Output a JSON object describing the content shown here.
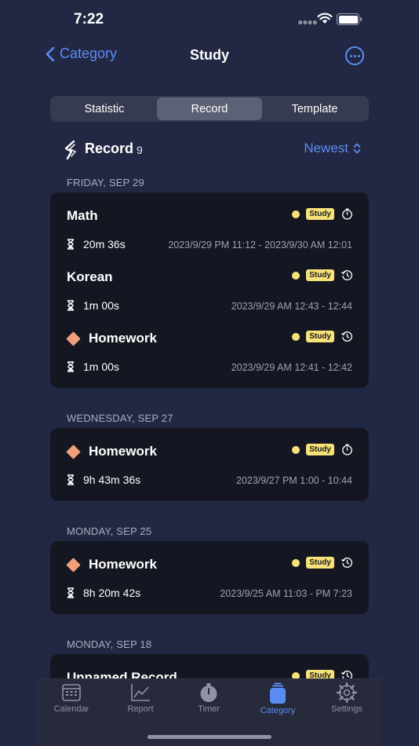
{
  "status": {
    "time": "7:22"
  },
  "nav": {
    "back_label": "Category",
    "title": "Study"
  },
  "segments": [
    {
      "label": "Statistic",
      "active": false
    },
    {
      "label": "Record",
      "active": true
    },
    {
      "label": "Template",
      "active": false
    }
  ],
  "record_header": {
    "label": "Record",
    "count": "9",
    "sort": "Newest"
  },
  "groups": [
    {
      "date": "FRIDAY, SEP 29",
      "records": [
        {
          "name": "Math",
          "has_icon": false,
          "badge": "Study",
          "duration": "20m 36s",
          "range": "2023/9/29 PM 11:12 - 2023/9/30 AM 12:01",
          "timer": "stopwatch"
        },
        {
          "name": "Korean",
          "has_icon": false,
          "badge": "Study",
          "duration": "1m 00s",
          "range": "2023/9/29 AM 12:43 - 12:44",
          "timer": "history"
        },
        {
          "name": "Homework",
          "has_icon": true,
          "badge": "Study",
          "duration": "1m 00s",
          "range": "2023/9/29 AM 12:41 - 12:42",
          "timer": "history"
        }
      ]
    },
    {
      "date": "WEDNESDAY, SEP 27",
      "records": [
        {
          "name": "Homework",
          "has_icon": true,
          "badge": "Study",
          "duration": "9h 43m 36s",
          "range": "2023/9/27 PM 1:00 - 10:44",
          "timer": "stopwatch"
        }
      ]
    },
    {
      "date": "MONDAY, SEP 25",
      "records": [
        {
          "name": "Homework",
          "has_icon": true,
          "badge": "Study",
          "duration": "8h 20m 42s",
          "range": "2023/9/25 AM 11:03 - PM 7:23",
          "timer": "history"
        }
      ]
    },
    {
      "date": "MONDAY, SEP 18",
      "records": [
        {
          "name": "Unnamed Record",
          "has_icon": false,
          "badge": "Study",
          "duration": "",
          "range": "",
          "timer": "history"
        }
      ]
    }
  ],
  "tabbar": [
    {
      "label": "Calendar",
      "icon": "calendar-icon",
      "active": false
    },
    {
      "label": "Report",
      "icon": "chart-icon",
      "active": false
    },
    {
      "label": "Timer",
      "icon": "timer-icon",
      "active": false
    },
    {
      "label": "Category",
      "icon": "category-icon",
      "active": true
    },
    {
      "label": "Settings",
      "icon": "gear-icon",
      "active": false
    }
  ],
  "colors": {
    "accent": "#5b8cf3",
    "background": "#222843",
    "card": "#141722",
    "badge": "#f7e27a",
    "diamond": "#f0a07b"
  }
}
